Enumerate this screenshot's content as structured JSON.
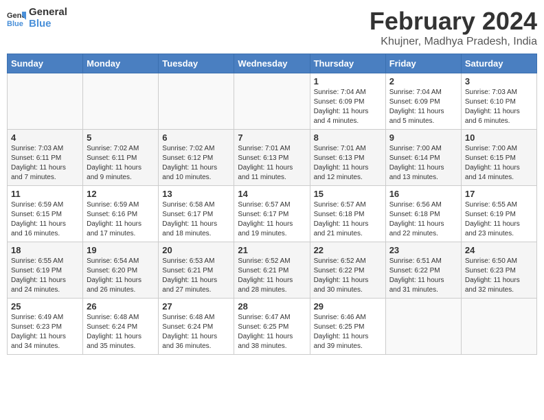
{
  "logo": {
    "line1": "General",
    "line2": "Blue"
  },
  "title": "February 2024",
  "subtitle": "Khujner, Madhya Pradesh, India",
  "days_header": [
    "Sunday",
    "Monday",
    "Tuesday",
    "Wednesday",
    "Thursday",
    "Friday",
    "Saturday"
  ],
  "weeks": [
    [
      {
        "day": "",
        "info": ""
      },
      {
        "day": "",
        "info": ""
      },
      {
        "day": "",
        "info": ""
      },
      {
        "day": "",
        "info": ""
      },
      {
        "day": "1",
        "info": "Sunrise: 7:04 AM\nSunset: 6:09 PM\nDaylight: 11 hours\nand 4 minutes."
      },
      {
        "day": "2",
        "info": "Sunrise: 7:04 AM\nSunset: 6:09 PM\nDaylight: 11 hours\nand 5 minutes."
      },
      {
        "day": "3",
        "info": "Sunrise: 7:03 AM\nSunset: 6:10 PM\nDaylight: 11 hours\nand 6 minutes."
      }
    ],
    [
      {
        "day": "4",
        "info": "Sunrise: 7:03 AM\nSunset: 6:11 PM\nDaylight: 11 hours\nand 7 minutes."
      },
      {
        "day": "5",
        "info": "Sunrise: 7:02 AM\nSunset: 6:11 PM\nDaylight: 11 hours\nand 9 minutes."
      },
      {
        "day": "6",
        "info": "Sunrise: 7:02 AM\nSunset: 6:12 PM\nDaylight: 11 hours\nand 10 minutes."
      },
      {
        "day": "7",
        "info": "Sunrise: 7:01 AM\nSunset: 6:13 PM\nDaylight: 11 hours\nand 11 minutes."
      },
      {
        "day": "8",
        "info": "Sunrise: 7:01 AM\nSunset: 6:13 PM\nDaylight: 11 hours\nand 12 minutes."
      },
      {
        "day": "9",
        "info": "Sunrise: 7:00 AM\nSunset: 6:14 PM\nDaylight: 11 hours\nand 13 minutes."
      },
      {
        "day": "10",
        "info": "Sunrise: 7:00 AM\nSunset: 6:15 PM\nDaylight: 11 hours\nand 14 minutes."
      }
    ],
    [
      {
        "day": "11",
        "info": "Sunrise: 6:59 AM\nSunset: 6:15 PM\nDaylight: 11 hours\nand 16 minutes."
      },
      {
        "day": "12",
        "info": "Sunrise: 6:59 AM\nSunset: 6:16 PM\nDaylight: 11 hours\nand 17 minutes."
      },
      {
        "day": "13",
        "info": "Sunrise: 6:58 AM\nSunset: 6:17 PM\nDaylight: 11 hours\nand 18 minutes."
      },
      {
        "day": "14",
        "info": "Sunrise: 6:57 AM\nSunset: 6:17 PM\nDaylight: 11 hours\nand 19 minutes."
      },
      {
        "day": "15",
        "info": "Sunrise: 6:57 AM\nSunset: 6:18 PM\nDaylight: 11 hours\nand 21 minutes."
      },
      {
        "day": "16",
        "info": "Sunrise: 6:56 AM\nSunset: 6:18 PM\nDaylight: 11 hours\nand 22 minutes."
      },
      {
        "day": "17",
        "info": "Sunrise: 6:55 AM\nSunset: 6:19 PM\nDaylight: 11 hours\nand 23 minutes."
      }
    ],
    [
      {
        "day": "18",
        "info": "Sunrise: 6:55 AM\nSunset: 6:19 PM\nDaylight: 11 hours\nand 24 minutes."
      },
      {
        "day": "19",
        "info": "Sunrise: 6:54 AM\nSunset: 6:20 PM\nDaylight: 11 hours\nand 26 minutes."
      },
      {
        "day": "20",
        "info": "Sunrise: 6:53 AM\nSunset: 6:21 PM\nDaylight: 11 hours\nand 27 minutes."
      },
      {
        "day": "21",
        "info": "Sunrise: 6:52 AM\nSunset: 6:21 PM\nDaylight: 11 hours\nand 28 minutes."
      },
      {
        "day": "22",
        "info": "Sunrise: 6:52 AM\nSunset: 6:22 PM\nDaylight: 11 hours\nand 30 minutes."
      },
      {
        "day": "23",
        "info": "Sunrise: 6:51 AM\nSunset: 6:22 PM\nDaylight: 11 hours\nand 31 minutes."
      },
      {
        "day": "24",
        "info": "Sunrise: 6:50 AM\nSunset: 6:23 PM\nDaylight: 11 hours\nand 32 minutes."
      }
    ],
    [
      {
        "day": "25",
        "info": "Sunrise: 6:49 AM\nSunset: 6:23 PM\nDaylight: 11 hours\nand 34 minutes."
      },
      {
        "day": "26",
        "info": "Sunrise: 6:48 AM\nSunset: 6:24 PM\nDaylight: 11 hours\nand 35 minutes."
      },
      {
        "day": "27",
        "info": "Sunrise: 6:48 AM\nSunset: 6:24 PM\nDaylight: 11 hours\nand 36 minutes."
      },
      {
        "day": "28",
        "info": "Sunrise: 6:47 AM\nSunset: 6:25 PM\nDaylight: 11 hours\nand 38 minutes."
      },
      {
        "day": "29",
        "info": "Sunrise: 6:46 AM\nSunset: 6:25 PM\nDaylight: 11 hours\nand 39 minutes."
      },
      {
        "day": "",
        "info": ""
      },
      {
        "day": "",
        "info": ""
      }
    ]
  ]
}
